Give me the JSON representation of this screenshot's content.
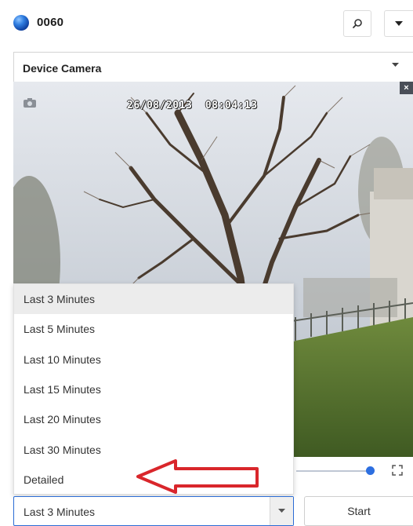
{
  "header": {
    "device_id": "0060",
    "search_icon": "search-icon",
    "menu_icon": "caret-down-icon"
  },
  "camera_select": {
    "selected": "Device Camera"
  },
  "camera_view": {
    "timestamp": "26/08/2013  08:04:13",
    "close_label": "×",
    "snapshot_icon": "camera-icon"
  },
  "playback": {
    "slider_position": 1.0
  },
  "time_range": {
    "options": [
      "Last 3 Minutes",
      "Last 5 Minutes",
      "Last 10 Minutes",
      "Last 15 Minutes",
      "Last 20 Minutes",
      "Last 30 Minutes",
      "Detailed"
    ],
    "highlighted": "Last 3 Minutes",
    "selected": "Last 3 Minutes"
  },
  "start_label": "Start",
  "colors": {
    "accent": "#2b6cd4",
    "annotation_arrow": "#d9262b"
  }
}
